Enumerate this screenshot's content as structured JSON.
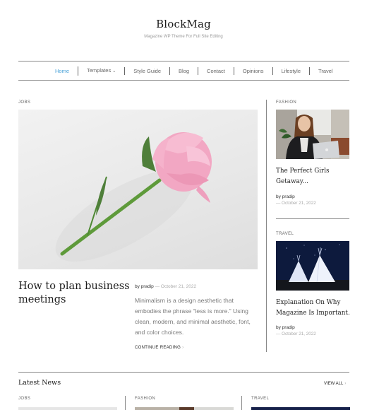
{
  "site": {
    "title": "BlockMag",
    "tagline": "Magazine WP Theme For Full Site Editing"
  },
  "nav": {
    "accent_color": "#4aa3d9",
    "items": [
      {
        "label": "Home",
        "active": true
      },
      {
        "label": "Templates",
        "has_dropdown": true,
        "chevron": "⌄"
      },
      {
        "label": "Style Guide"
      },
      {
        "label": "Blog"
      },
      {
        "label": "Contact"
      },
      {
        "label": "Opinions"
      },
      {
        "label": "Lifestyle"
      },
      {
        "label": "Travel"
      }
    ]
  },
  "featured": {
    "category": "JOBS",
    "image": "pink-rose-on-white",
    "title": "How to plan business meetings",
    "author_prefix": "by",
    "author": "pradip",
    "date": "— October 21, 2022",
    "excerpt": "Minimalism is a design aesthetic that embodies the phrase “less is more.” Using clean, modern, and minimal aesthetic, font, and color choices.",
    "continue_label": "CONTINUE READING",
    "continue_arrow": "›"
  },
  "sidebar": {
    "posts": [
      {
        "category": "FASHION",
        "image": "woman-with-laptop",
        "title": "The Perfect Girls Getaway...",
        "author": "by pradip",
        "date": "— October 21, 2022"
      },
      {
        "category": "TRAVEL",
        "image": "teepees-at-night",
        "title": "Explanation On Why Magazine Is Important.",
        "author": "by pradip",
        "date": "— October 21, 2022"
      }
    ]
  },
  "latest": {
    "heading": "Latest News",
    "view_all_label": "VIEW ALL",
    "view_all_arrow": "›",
    "columns": [
      {
        "category": "JOBS"
      },
      {
        "category": "FASHION"
      },
      {
        "category": "TRAVEL"
      }
    ]
  }
}
